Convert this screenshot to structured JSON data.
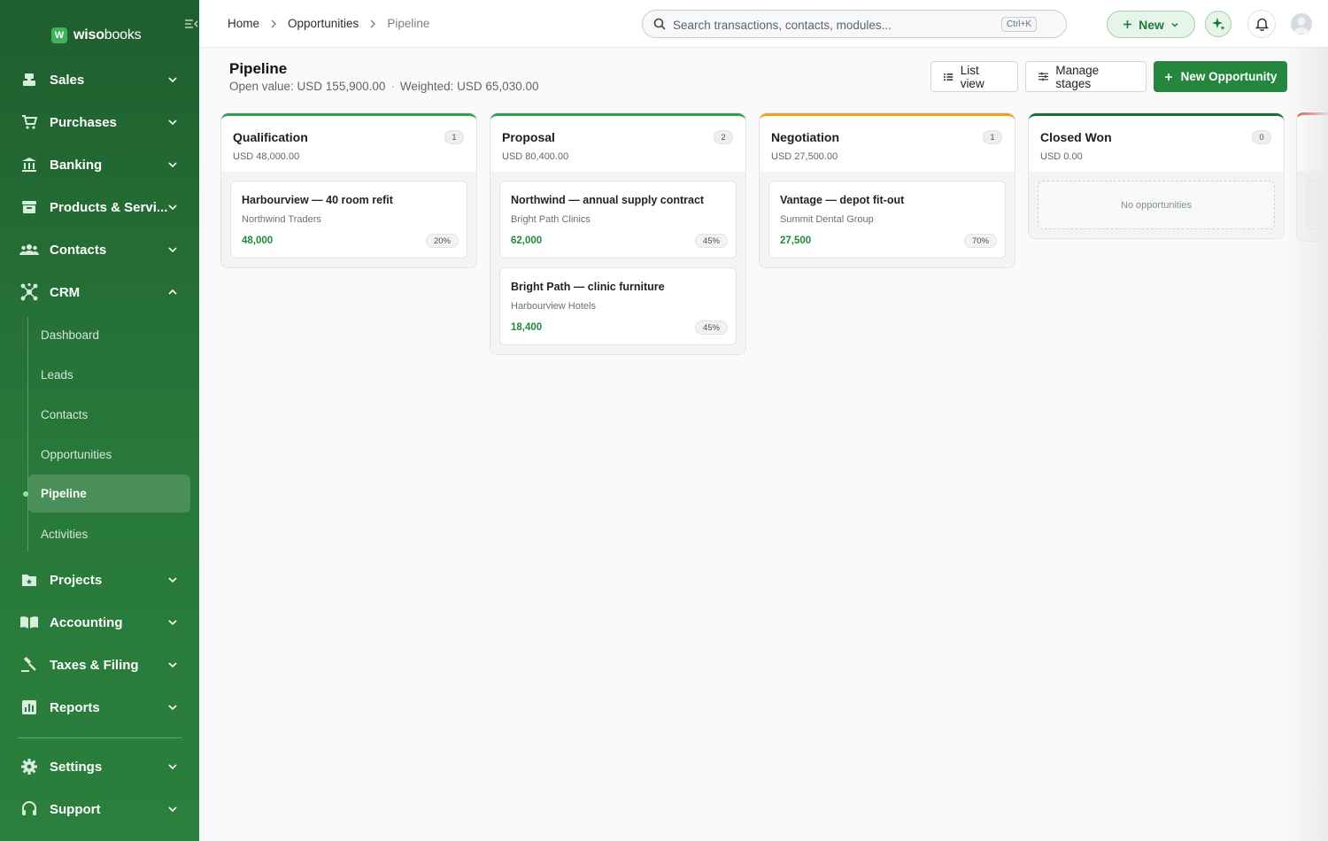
{
  "brand": {
    "name_bold": "wiso",
    "name_light": "books",
    "mark": "W"
  },
  "sidebar": {
    "items": [
      {
        "id": "sales",
        "label": "Sales",
        "icon": "register-icon"
      },
      {
        "id": "purchases",
        "label": "Purchases",
        "icon": "cart-icon"
      },
      {
        "id": "banking",
        "label": "Banking",
        "icon": "bank-icon"
      },
      {
        "id": "products",
        "label": "Products & Servi...",
        "icon": "archive-icon"
      },
      {
        "id": "contacts",
        "label": "Contacts",
        "icon": "people-icon"
      },
      {
        "id": "crm",
        "label": "CRM",
        "icon": "hub-icon",
        "expanded": true
      },
      {
        "id": "projects",
        "label": "Projects",
        "icon": "folder-icon"
      },
      {
        "id": "accounting",
        "label": "Accounting",
        "icon": "book-icon"
      },
      {
        "id": "taxes",
        "label": "Taxes & Filing",
        "icon": "gavel-icon"
      },
      {
        "id": "reports",
        "label": "Reports",
        "icon": "chart-icon"
      },
      {
        "id": "settings",
        "label": "Settings",
        "icon": "gear-icon"
      },
      {
        "id": "support",
        "label": "Support",
        "icon": "headset-icon"
      }
    ],
    "crm_sub": [
      "Dashboard",
      "Leads",
      "Contacts",
      "Opportunities",
      "Pipeline",
      "Activities"
    ],
    "active_sub": "Pipeline"
  },
  "topbar": {
    "breadcrumb": [
      "Home",
      "Opportunities",
      "Pipeline"
    ],
    "search_placeholder": "Search transactions, contacts, modules...",
    "search_shortcut": "Ctrl+K",
    "new_label": "New"
  },
  "page": {
    "title": "Pipeline",
    "open_value": "Open value: USD 155,900.00",
    "weighted_value": "Weighted: USD 65,030.00",
    "separator": "·",
    "list_view_label": "List view",
    "manage_stages_label": "Manage stages",
    "new_opportunity_label": "New Opportunity"
  },
  "stages": [
    {
      "name": "Qualification",
      "total": "USD 48,000.00",
      "count": "1",
      "color": "#2f9e4f",
      "cards": [
        {
          "title": "Harbourview — 40 room refit",
          "company": "Northwind Traders",
          "amount": "48,000",
          "probability": "20%"
        }
      ]
    },
    {
      "name": "Proposal",
      "total": "USD 80,400.00",
      "count": "2",
      "color": "#2f9e4f",
      "cards": [
        {
          "title": "Northwind — annual supply contract",
          "company": "Bright Path Clinics",
          "amount": "62,000",
          "probability": "45%"
        },
        {
          "title": "Bright Path — clinic furniture",
          "company": "Harbourview Hotels",
          "amount": "18,400",
          "probability": "45%"
        }
      ]
    },
    {
      "name": "Negotiation",
      "total": "USD 27,500.00",
      "count": "1",
      "color": "#f0a020",
      "cards": [
        {
          "title": "Vantage — depot fit-out",
          "company": "Summit Dental Group",
          "amount": "27,500",
          "probability": "70%"
        }
      ]
    },
    {
      "name": "Closed Won",
      "total": "USD 0.00",
      "count": "0",
      "color": "#1e6b3a",
      "cards": [],
      "empty_text": "No opportunities"
    }
  ],
  "colors": {
    "accent": "#24873d",
    "sidebar": "#28793a",
    "lost": "#d93a2b"
  }
}
